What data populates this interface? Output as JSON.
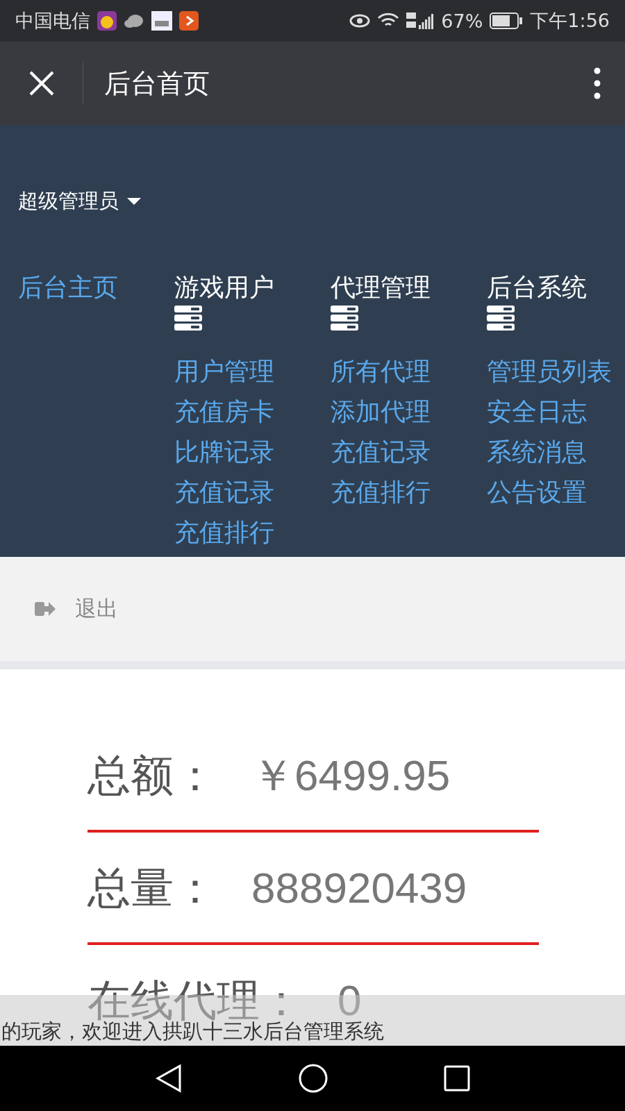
{
  "status_bar": {
    "carrier": "中国电信",
    "battery": "67%",
    "time": "下午1:56"
  },
  "header": {
    "title": "后台首页"
  },
  "user_menu": {
    "label": "超级管理员"
  },
  "nav": [
    {
      "label": "后台主页",
      "selected": true,
      "kind": "link"
    },
    {
      "label": "游戏用户",
      "selected": false,
      "kind": "group",
      "items": [
        "用户管理",
        "充值房卡",
        "比牌记录",
        "充值记录",
        "充值排行"
      ]
    },
    {
      "label": "代理管理",
      "selected": false,
      "kind": "group",
      "items": [
        "所有代理",
        "添加代理",
        "充值记录",
        "充值排行"
      ]
    },
    {
      "label": "后台系统",
      "selected": false,
      "kind": "group",
      "items": [
        "管理员列表",
        "安全日志",
        "系统消息",
        "公告设置"
      ]
    }
  ],
  "logout": {
    "label": "退出"
  },
  "stats": [
    {
      "label": "总额：",
      "value": "￥6499.95"
    },
    {
      "label": "总量：",
      "value": "888920439"
    },
    {
      "label": "在线代理：",
      "value": "0"
    }
  ],
  "marquee": {
    "text": "的玩家，欢迎进入拱趴十三水后台管理系统"
  }
}
